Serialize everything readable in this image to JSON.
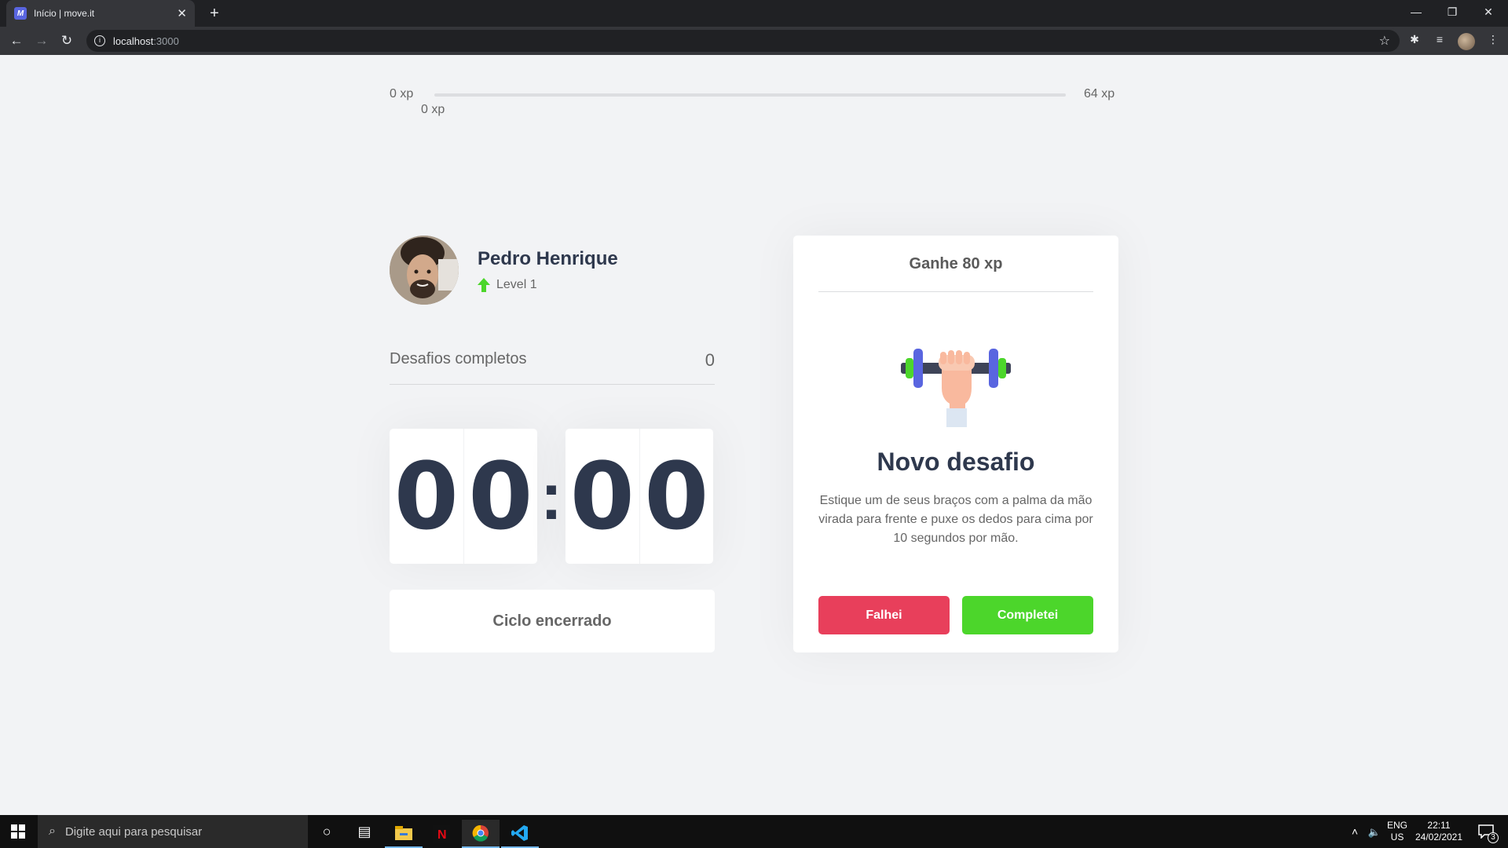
{
  "browser": {
    "tab_title": "Início | move.it",
    "favicon_text": "M",
    "url_host": "localhost",
    "url_port": ":3000"
  },
  "xp_bar": {
    "min_label": "0 xp",
    "max_label": "64 xp",
    "current_label": "0 xp",
    "progress_fraction": 0.0
  },
  "profile": {
    "name": "Pedro Henrique",
    "level_label": "Level 1"
  },
  "completed": {
    "label": "Desafios completos",
    "count": "0"
  },
  "countdown": {
    "minute_left": "0",
    "minute_right": "0",
    "separator": ":",
    "second_left": "0",
    "second_right": "0"
  },
  "cycle_button": {
    "label": "Ciclo encerrado"
  },
  "challenge": {
    "header": "Ganhe 80 xp",
    "title": "Novo desafio",
    "description": "Estique um de seus braços com a palma da mão virada para frente e puxe os dedos para cima por 10 segundos por mão.",
    "fail_label": "Falhei",
    "complete_label": "Completei"
  },
  "taskbar": {
    "search_placeholder": "Digite aqui para pesquisar",
    "lang_top": "ENG",
    "lang_bottom": "US",
    "time": "22:11",
    "date": "24/02/2021",
    "notifications_count": "3"
  },
  "colors": {
    "red": "#e83f5b",
    "green": "#4cd62b",
    "title": "#2e384d",
    "text": "#666666",
    "background": "#f2f3f5"
  }
}
